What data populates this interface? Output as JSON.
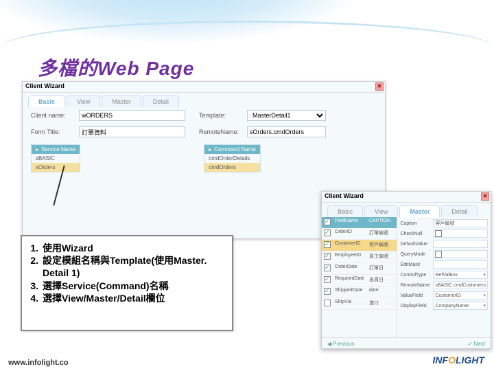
{
  "title": "多檔的Web Page",
  "wizard1": {
    "title": "Client Wizard",
    "tabs": [
      "Basic",
      "View",
      "Master",
      "Detail"
    ],
    "active_tab": 0,
    "fields": {
      "client_name_label": "Client name:",
      "client_name_value": "wORDERS",
      "template_label": "Template:",
      "template_value": "MasterDetail1",
      "form_title_label": "Form Title:",
      "form_title_value": "訂單資料",
      "remote_label": "RemoteName:",
      "remote_value": "sOrders.cmdOrders"
    },
    "left_grid": {
      "header": "Service Name",
      "rows": [
        "sBASIC",
        "sOrders"
      ]
    },
    "right_grid": {
      "header": "Command Name",
      "rows": [
        "cmdOrderDetails",
        "cmdOrders"
      ]
    }
  },
  "wizard2": {
    "title": "Client Wizard",
    "tabs": [
      "Basic",
      "View",
      "Master",
      "Detail"
    ],
    "active_tab": 2,
    "grid_headers": {
      "ck": "",
      "field": "FieldName",
      "caption": "CAPTION"
    },
    "rows": [
      {
        "ck": true,
        "field": "OrderID",
        "caption": "訂單編號",
        "sel": false
      },
      {
        "ck": true,
        "field": "CustomerID",
        "caption": "客戶編號",
        "sel": true
      },
      {
        "ck": true,
        "field": "EmployeeID",
        "caption": "員工編號",
        "sel": false
      },
      {
        "ck": true,
        "field": "OrderDate",
        "caption": "訂單日",
        "sel": false
      },
      {
        "ck": true,
        "field": "RequiredDate",
        "caption": "出貨日",
        "sel": false
      },
      {
        "ck": true,
        "field": "ShippedDate",
        "caption": "date",
        "sel": false
      },
      {
        "ck": false,
        "field": "ShipVia",
        "caption": "港口",
        "sel": false
      }
    ],
    "props": {
      "caption_label": "Caption",
      "caption_value": "客戶編號",
      "checknull_label": "CheckNull",
      "checknull_value": "",
      "default_label": "DefaultValue",
      "default_value": "",
      "query_label": "QueryMode",
      "query_value": "",
      "edit_label": "EditMask",
      "edit_value": "",
      "control_label": "ControlType",
      "control_value": "RefValBox",
      "remote_label": "RemoteName",
      "remote_value": "sBASIC.cmdCustomers",
      "valuef_label": "ValueField",
      "valuef_value": "CustomerID",
      "dispf_label": "DisplayField",
      "dispf_value": "CompanyName"
    },
    "footer": {
      "prev": "Previous",
      "next": "Next"
    }
  },
  "steps": [
    {
      "n": "1.",
      "t": "使用Wizard"
    },
    {
      "n": "2.",
      "t": "設定模組名稱與Template(使用Master. Detail 1)"
    },
    {
      "n": "3.",
      "t": "選擇Service(Command)名稱"
    },
    {
      "n": "4.",
      "t": "選擇View/Master/Detail欄位"
    }
  ],
  "footer_url": "www.infolight.co",
  "logo": {
    "p1": "INF",
    "p2": "O",
    "p3": "LIGHT"
  }
}
